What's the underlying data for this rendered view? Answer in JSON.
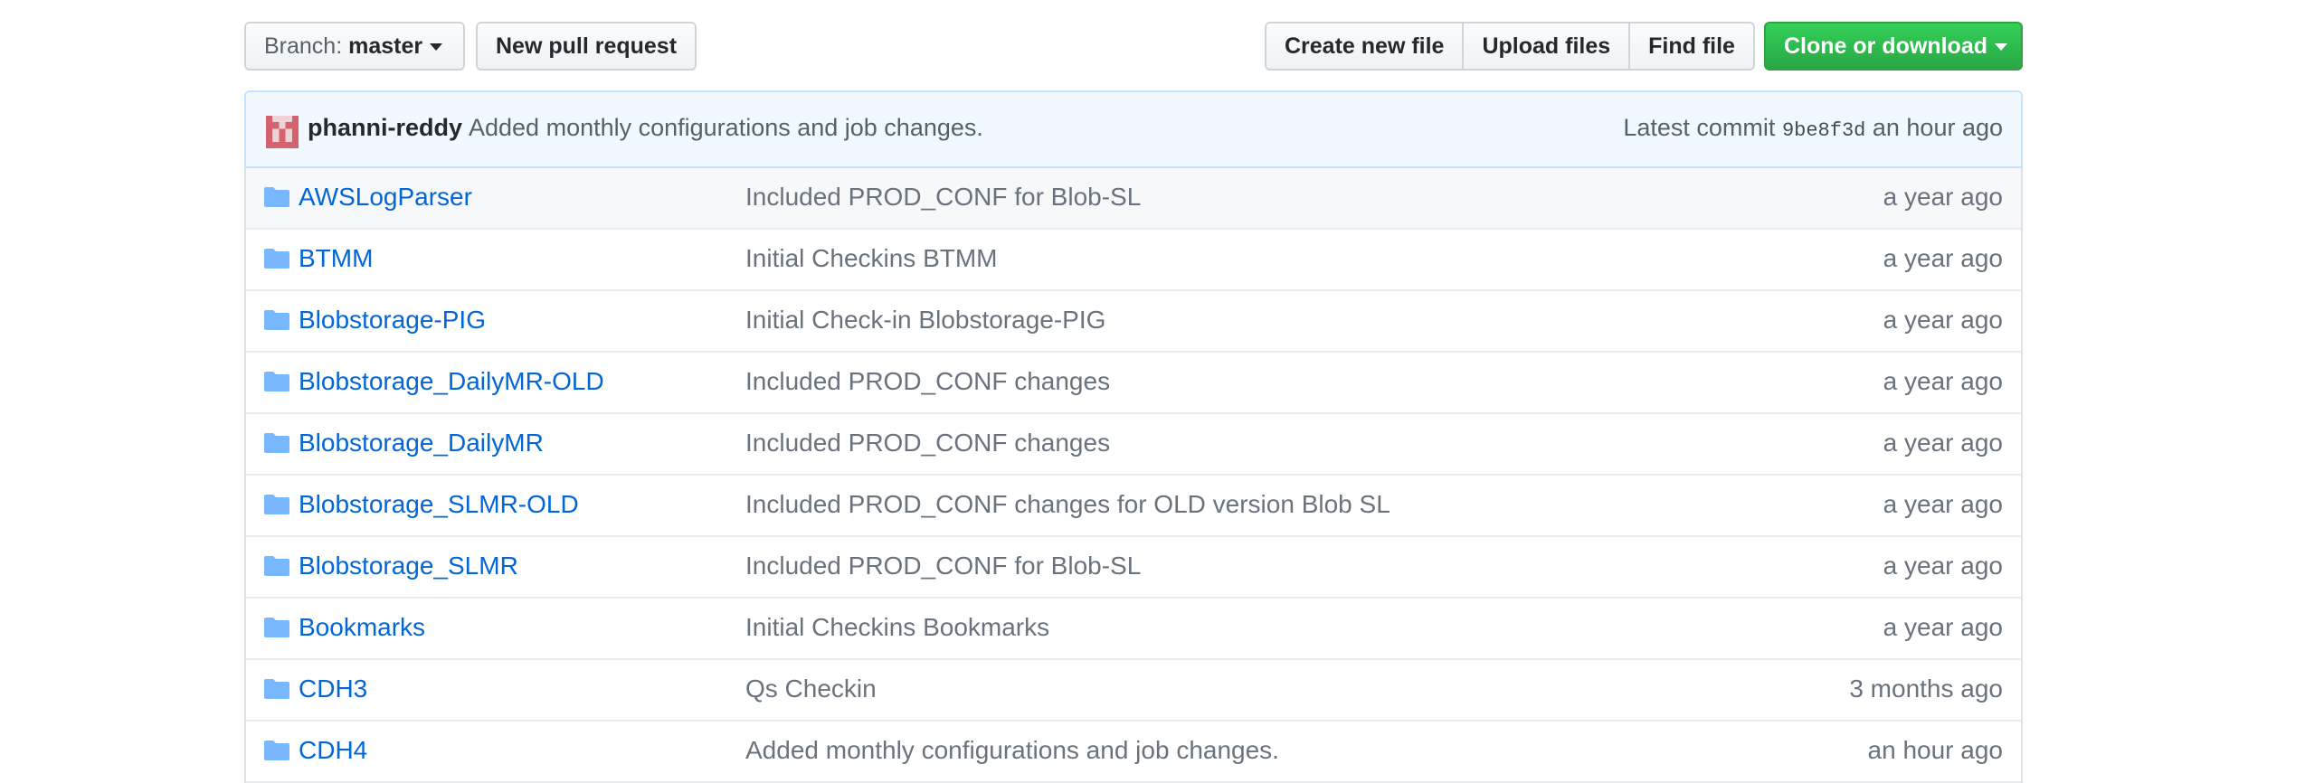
{
  "toolbar": {
    "branch_prefix": "Branch:",
    "branch_name": "master",
    "new_pr_label": "New pull request",
    "create_file_label": "Create new file",
    "upload_files_label": "Upload files",
    "find_file_label": "Find file",
    "clone_label": "Clone or download"
  },
  "commit": {
    "author": "phanni-reddy",
    "message": "Added monthly configurations and job changes.",
    "latest_prefix": "Latest commit",
    "sha": "9be8f3d",
    "age": "an hour ago"
  },
  "files": [
    {
      "name": "AWSLogParser",
      "message": "Included PROD_CONF for Blob-SL",
      "age": "a year ago"
    },
    {
      "name": "BTMM",
      "message": "Initial Checkins BTMM",
      "age": "a year ago"
    },
    {
      "name": "Blobstorage-PIG",
      "message": "Initial Check-in Blobstorage-PIG",
      "age": "a year ago"
    },
    {
      "name": "Blobstorage_DailyMR-OLD",
      "message": "Included PROD_CONF changes",
      "age": "a year ago"
    },
    {
      "name": "Blobstorage_DailyMR",
      "message": "Included PROD_CONF changes",
      "age": "a year ago"
    },
    {
      "name": "Blobstorage_SLMR-OLD",
      "message": "Included PROD_CONF changes for OLD version Blob SL",
      "age": "a year ago"
    },
    {
      "name": "Blobstorage_SLMR",
      "message": "Included PROD_CONF for Blob-SL",
      "age": "a year ago"
    },
    {
      "name": "Bookmarks",
      "message": "Initial Checkins Bookmarks",
      "age": "a year ago"
    },
    {
      "name": "CDH3",
      "message": "Qs Checkin",
      "age": "3 months ago"
    },
    {
      "name": "CDH4",
      "message": "Added monthly configurations and job changes.",
      "age": "an hour ago"
    }
  ],
  "colors": {
    "link": "#0366d6",
    "folder_icon": "#79b8ff",
    "clone_button": "#28a745",
    "commit_bar_bg": "#f1f8ff"
  },
  "icons": {
    "folder": "folder-icon",
    "avatar": "identicon-avatar"
  }
}
